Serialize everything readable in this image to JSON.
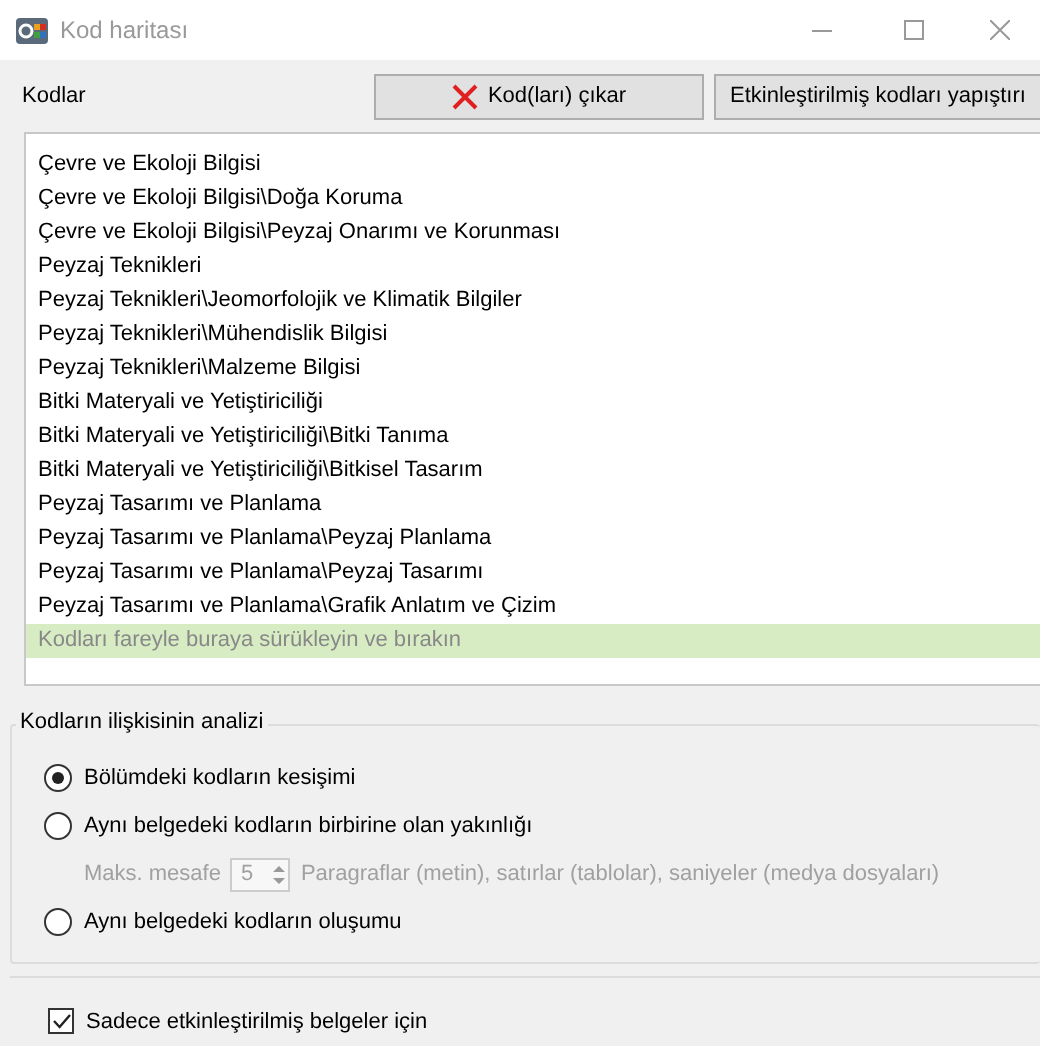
{
  "window": {
    "title": "Kod haritası"
  },
  "toolbar": {
    "label": "Kodlar",
    "buttons": [
      {
        "label": "Kod(ları) çıkar",
        "kind": "remove"
      },
      {
        "label": "Etkinleştirilmiş kodları yapıştırı",
        "kind": "plain"
      }
    ]
  },
  "codes": [
    "Çevre ve Ekoloji Bilgisi",
    "Çevre ve Ekoloji Bilgisi\\Doğa Koruma",
    "Çevre ve Ekoloji Bilgisi\\Peyzaj Onarımı ve Korunması",
    "Peyzaj Teknikleri",
    "Peyzaj Teknikleri\\Jeomorfolojik ve Klimatik Bilgiler",
    "Peyzaj Teknikleri\\Mühendislik Bilgisi",
    "Peyzaj Teknikleri\\Malzeme Bilgisi",
    "Bitki Materyali ve Yetiştiriciliği",
    "Bitki Materyali ve Yetiştiriciliği\\Bitki Tanıma",
    "Bitki Materyali ve Yetiştiriciliği\\Bitkisel Tasarım",
    "Peyzaj Tasarımı ve Planlama",
    "Peyzaj Tasarımı ve Planlama\\Peyzaj Planlama",
    "Peyzaj Tasarımı ve Planlama\\Peyzaj Tasarımı",
    "Peyzaj Tasarımı ve Planlama\\Grafik Anlatım ve Çizim"
  ],
  "drop_hint": "Kodları fareyle buraya sürükleyin ve bırakın",
  "analysis": {
    "title": "Kodların ilişkisinin analizi",
    "options": [
      {
        "label": "Bölümdeki kodların kesişimi",
        "selected": true
      },
      {
        "label": "Aynı belgedeki kodların birbirine olan yakınlığı",
        "selected": false,
        "distance": {
          "label": "Maks. mesafe",
          "value": "5",
          "unit": "Paragraflar (metin), satırlar (tablolar), saniyeler (medya dosyaları)",
          "disabled": true
        }
      },
      {
        "label": "Aynı belgedeki kodların oluşumu",
        "selected": false
      }
    ]
  },
  "only_activated": {
    "label": "Sadece etkinleştirilmiş belgeler için",
    "checked": true
  }
}
